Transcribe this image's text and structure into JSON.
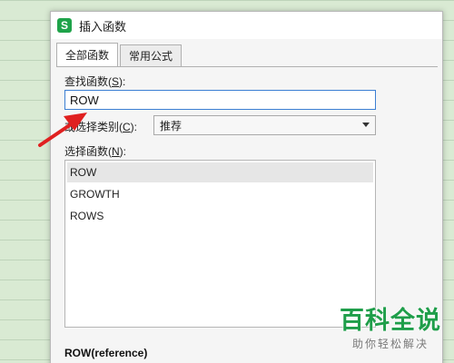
{
  "dialog": {
    "title": "插入函数",
    "app_icon_glyph": "S"
  },
  "tabs": [
    {
      "label": "全部函数",
      "active": true
    },
    {
      "label": "常用公式",
      "active": false
    }
  ],
  "search": {
    "label_prefix": "查找函数(",
    "label_key": "S",
    "label_suffix": "):",
    "value": "ROW"
  },
  "category": {
    "label_prefix": "或选择类别(",
    "label_key": "C",
    "label_suffix": "):",
    "selected": "推荐"
  },
  "function_list": {
    "label_prefix": "选择函数(",
    "label_key": "N",
    "label_suffix": "):",
    "items": [
      "ROW",
      "GROWTH",
      "ROWS"
    ],
    "selected_index": 0
  },
  "signature": "ROW(reference)",
  "watermark": {
    "logo": "百科全说",
    "subtitle": "助你轻松解决"
  },
  "colors": {
    "accent_blue": "#3c7fd3",
    "brand_green": "#1f9e4a",
    "arrow_red": "#e02020"
  }
}
